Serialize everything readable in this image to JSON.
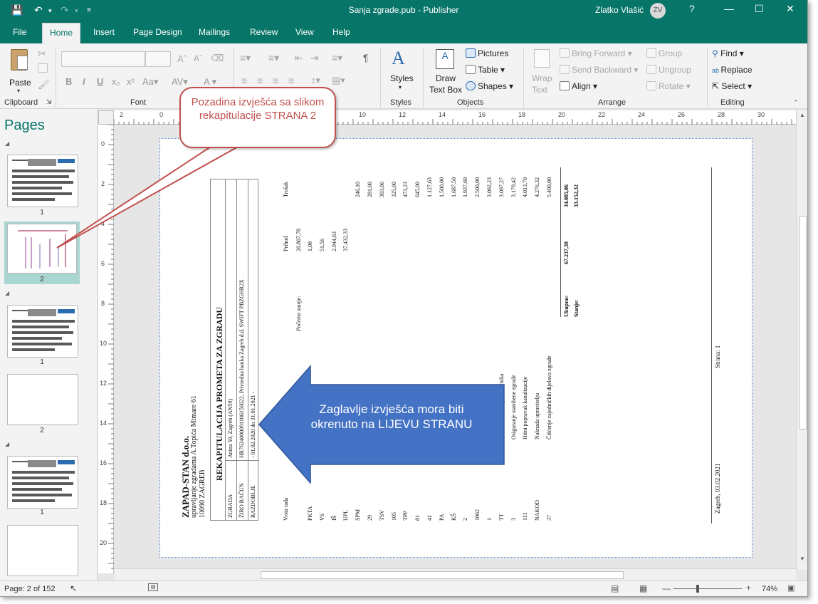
{
  "titlebar": {
    "title": "Sanja zgrade.pub - Publisher",
    "user": "Zlatko Vlašić",
    "avatar": "ZV",
    "help": "?",
    "icons": [
      "save-icon",
      "undo-icon",
      "redo-icon",
      "customize-icon",
      "ribbon-display-icon",
      "minimize-icon",
      "maximize-icon",
      "close-icon"
    ]
  },
  "tabs": [
    "File",
    "Home",
    "Insert",
    "Page Design",
    "Mailings",
    "Review",
    "View",
    "Help"
  ],
  "active_tab": "Home",
  "ribbon": {
    "clipboard": {
      "label": "Clipboard",
      "paste": "Paste"
    },
    "font": {
      "label": "Font"
    },
    "styles": {
      "label": "Styles",
      "button": "Styles"
    },
    "objects": {
      "label": "Objects",
      "draw_text_box": "Draw\nText Box",
      "draw": "Draw",
      "text_box": "Text Box",
      "pictures": "Pictures",
      "table": "Table",
      "shapes": "Shapes"
    },
    "arrange": {
      "label": "Arrange",
      "wrap": "Wrap",
      "text": "Text",
      "bring_forward": "Bring Forward",
      "send_backward": "Send Backward",
      "align": "Align",
      "group": "Group",
      "ungroup": "Ungroup",
      "rotate": "Rotate"
    },
    "editing": {
      "label": "Editing",
      "find": "Find",
      "replace": "Replace",
      "select": "Select"
    }
  },
  "pages_pane": {
    "title": "Pages",
    "thumbnails": [
      "1",
      "2",
      "1",
      "2",
      "1",
      "2"
    ]
  },
  "ruler": {
    "h_ticks": [
      "2",
      "0",
      "2",
      "4",
      "6",
      "8",
      "10",
      "12",
      "14",
      "16",
      "18",
      "20",
      "22",
      "24",
      "26",
      "28",
      "30"
    ],
    "v_ticks": [
      "0",
      "2",
      "4",
      "6",
      "8",
      "10",
      "12",
      "14",
      "16",
      "18",
      "20"
    ]
  },
  "document": {
    "company": "ZAPAD-STAN d.o.o.",
    "company_sub": "upravljanje zgradama A.Topića Mimare 61",
    "city": "10090 ZAGREB",
    "heading": "REKAPITULACIJA PROMETA ZA ZGRADU",
    "info": [
      {
        "k": "ZGRADA",
        "v": "Anina 59, Zagreb (AN59)"
      },
      {
        "k": "ŽIRO RAČUN",
        "v": "HR7624000091106156622, Privredna banka Zagreb d.d. SWIFT PBZGHR2X"
      },
      {
        "k": "RAZDOBLJE",
        "v": "- 01.02.2020 do 31.01.2021 -"
      }
    ],
    "columns": {
      "type": "Vrsta rada",
      "income": "Prihod",
      "cost": "Trošak"
    },
    "opening_label": "Početno stanje:",
    "rows": [
      {
        "code": "",
        "name": "Početno stanje:",
        "income": "26.807,78",
        "cost": ""
      },
      {
        "code": "PKTA",
        "name": "",
        "income": "1,08",
        "cost": ""
      },
      {
        "code": "VS",
        "name": "",
        "income": "51,56",
        "cost": ""
      },
      {
        "code": "IŠ",
        "name": "",
        "income": "2.944,63",
        "cost": ""
      },
      {
        "code": "UPL",
        "name": "",
        "income": "37.432,33",
        "cost": ""
      },
      {
        "code": "SPM",
        "name": "",
        "income": "",
        "cost": "246,10"
      },
      {
        "code": "29",
        "name": "",
        "income": "",
        "cost": "281,00"
      },
      {
        "code": "TSV",
        "name": "",
        "income": "",
        "cost": "303,06"
      },
      {
        "code": "105",
        "name": "",
        "income": "",
        "cost": "325,00"
      },
      {
        "code": "TPP",
        "name": "",
        "income": "",
        "cost": "473,23"
      },
      {
        "code": "81",
        "name": "",
        "income": "",
        "cost": "645,00"
      },
      {
        "code": "41",
        "name": "",
        "income": "",
        "cost": "1.127,63"
      },
      {
        "code": "PA",
        "name": "",
        "income": "",
        "cost": "1.500,00"
      },
      {
        "code": "KŠ",
        "name": "",
        "income": "",
        "cost": "1.687,50"
      },
      {
        "code": "2",
        "name": "",
        "income": "",
        "cost": "1.937,60"
      },
      {
        "code": "1062",
        "name": "",
        "income": "",
        "cost": "2.500,00"
      },
      {
        "code": "1",
        "name": "...roja el.energije",
        "income": "",
        "cost": "3.092,23"
      },
      {
        "code": "TT",
        "name": "Trošak telefona predstavnika",
        "income": "",
        "cost": "3.097,27"
      },
      {
        "code": "3",
        "name": "Osiguranje stambene zgrade",
        "income": "",
        "cost": "3.179,42"
      },
      {
        "code": "111",
        "name": "Hitni popravak kanalizacije",
        "income": "",
        "cost": "4.013,70"
      },
      {
        "code": "NAKOD",
        "name": "Naknada upravitelju",
        "income": "",
        "cost": "4.276,32"
      },
      {
        "code": "37",
        "name": "Čišćenje zajedničkih dijelova zgrade",
        "income": "",
        "cost": "5.400,00"
      }
    ],
    "totals": {
      "label1": "Ukupno:",
      "label2": "Stanje:",
      "income": "67.237,38",
      "cost1": "34.085,06",
      "cost2": "33.152,32"
    },
    "footer_left": "Zagreb, 03.02.2021",
    "footer_right": "Strana: 1"
  },
  "callouts": {
    "top": "Pozadina izvješća sa slikom rekapitulacije STRANA 2",
    "arrow": "Zaglavlje izvješća mora biti okrenuto na LIJEVU STRANU"
  },
  "colors": {
    "accent": "#077568",
    "callout_red": "#c0504d",
    "callout_blue": "#4472c4"
  },
  "status": {
    "page": "Page: 2 of 152",
    "zoom": "74%"
  }
}
